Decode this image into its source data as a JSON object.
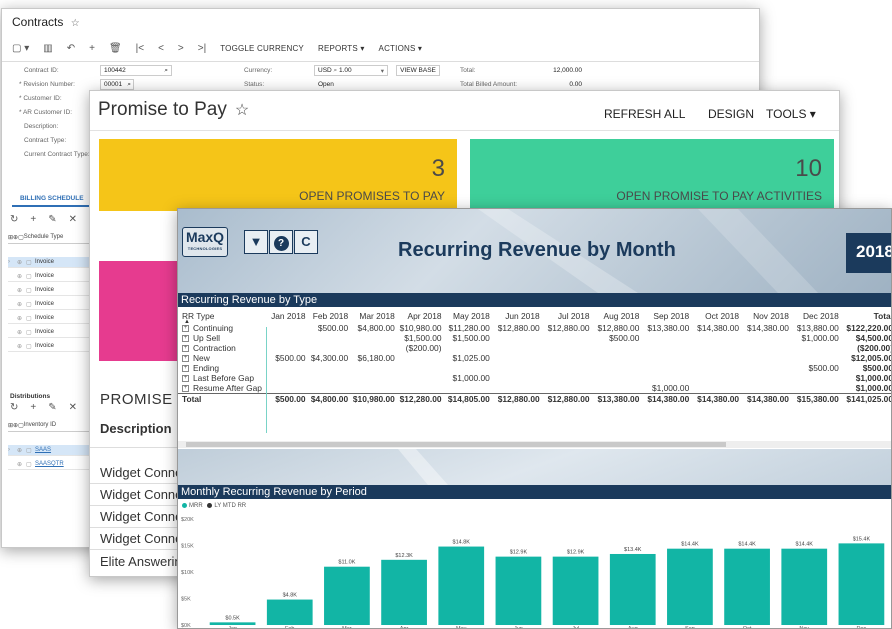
{
  "contracts": {
    "title": "Contracts",
    "star": "☆",
    "toolbar_icons": [
      "▢ ▾",
      "▥",
      "↶",
      "+",
      "🗑",
      "|<",
      "<",
      ">",
      ">|"
    ],
    "toolbar_text": [
      "TOGGLE CURRENCY",
      "REPORTS ▾",
      "ACTIONS ▾"
    ],
    "fields": [
      {
        "label": "Contract ID:",
        "value": "100442"
      },
      {
        "label": "* Revision Number:",
        "value": "00001"
      },
      {
        "label": "* Customer ID:",
        "value": ""
      },
      {
        "label": "* AR Customer ID:",
        "value": ""
      },
      {
        "label": "Description:",
        "value": ""
      },
      {
        "label": "Contract Type:",
        "value": ""
      },
      {
        "label": "Current Contract Type:",
        "value": ""
      }
    ],
    "currency_label": "Currency:",
    "currency_value": "USD",
    "rate": "1.00",
    "view_base": "VIEW BASE",
    "status_label": "Status:",
    "status_value": "Open",
    "total_label": "Total:",
    "total_value": "12,000.00",
    "billed_label": "Total Billed Amount:",
    "billed_value": "0.00",
    "billing_tab": "BILLING SCHEDULE",
    "billing_header": "Schedule Type",
    "billing_rows": [
      "Invoice",
      "Invoice",
      "Invoice",
      "Invoice",
      "Invoice",
      "Invoice",
      "Invoice"
    ],
    "distributions_label": "Distributions",
    "dist_header": "Inventory ID",
    "dist_rows": [
      "SAAS",
      "SAASQTR"
    ]
  },
  "ptp": {
    "title": "Promise to Pay",
    "star": "☆",
    "refresh": "REFRESH ALL",
    "design": "DESIGN",
    "tools": "TOOLS ▾",
    "tile1_num": "3",
    "tile1_label": "OPEN PROMISES TO PAY",
    "tile2_num": "10",
    "tile2_label": "OPEN PROMISE TO PAY ACTIVITIES",
    "section": "PROMISE",
    "desc_header": "Description",
    "rows": [
      "Widget Conne",
      "Widget Conne",
      "Widget Conne",
      "Widget Conne",
      "Elite Answerin"
    ]
  },
  "rr": {
    "logo": "MaxQ",
    "logo_sub": "TECHNOLOGIES",
    "btn_filter": "▼",
    "btn_help": "?",
    "btn_refresh": "C",
    "title": "Recurring Revenue by Month",
    "year": "2018",
    "section1": "Recurring Revenue by Type",
    "section2": "Monthly Recurring Revenue by Period",
    "table": {
      "headers": [
        "RR Type",
        "Jan 2018",
        "Feb 2018",
        "Mar 2018",
        "Apr 2018",
        "May 2018",
        "Jun 2018",
        "Jul 2018",
        "Aug 2018",
        "Sep 2018",
        "Oct 2018",
        "Nov 2018",
        "Dec 2018",
        "Total"
      ],
      "rows": [
        [
          "Continuing",
          "",
          "$500.00",
          "$4,800.00",
          "$10,980.00",
          "$11,280.00",
          "$12,880.00",
          "$12,880.00",
          "$12,880.00",
          "$13,380.00",
          "$14,380.00",
          "$14,380.00",
          "$13,880.00",
          "$122,220.00"
        ],
        [
          "Up Sell",
          "",
          "",
          "",
          "$1,500.00",
          "$1,500.00",
          "",
          "",
          "$500.00",
          "",
          "",
          "",
          "$1,000.00",
          "$4,500.00"
        ],
        [
          "Contraction",
          "",
          "",
          "",
          "($200.00)",
          "",
          "",
          "",
          "",
          "",
          "",
          "",
          "",
          "($200.00)"
        ],
        [
          "New",
          "$500.00",
          "$4,300.00",
          "$6,180.00",
          "",
          "$1,025.00",
          "",
          "",
          "",
          "",
          "",
          "",
          "",
          "$12,005.00"
        ],
        [
          "Ending",
          "",
          "",
          "",
          "",
          "",
          "",
          "",
          "",
          "",
          "",
          "",
          "$500.00",
          "$500.00"
        ],
        [
          "Last Before Gap",
          "",
          "",
          "",
          "",
          "$1,000.00",
          "",
          "",
          "",
          "",
          "",
          "",
          "",
          "$1,000.00"
        ],
        [
          "Resume After Gap",
          "",
          "",
          "",
          "",
          "",
          "",
          "",
          "",
          "$1,000.00",
          "",
          "",
          "",
          "$1,000.00"
        ]
      ],
      "total": [
        "Total",
        "$500.00",
        "$4,800.00",
        "$10,980.00",
        "$12,280.00",
        "$14,805.00",
        "$12,880.00",
        "$12,880.00",
        "$13,380.00",
        "$14,380.00",
        "$14,380.00",
        "$14,380.00",
        "$15,380.00",
        "$141,025.00"
      ]
    },
    "legend_mrr": "MRR",
    "legend_ly": "LY MTD RR",
    "colors": {
      "navy": "#1b3a5c",
      "teal": "#12b5a5",
      "legend_ly": "#333333"
    }
  },
  "chart_data": {
    "type": "bar",
    "categories": [
      "Jan",
      "Feb",
      "Mar",
      "Apr",
      "May",
      "Jun",
      "Jul",
      "Aug",
      "Sep",
      "Oct",
      "Nov",
      "Dec"
    ],
    "values": [
      0.5,
      4.8,
      11.0,
      12.3,
      14.8,
      12.9,
      12.9,
      13.4,
      14.4,
      14.4,
      14.4,
      15.4
    ],
    "labels": [
      "$0.5K",
      "$4.8K",
      "$11.0K",
      "$12.3K",
      "$14.8K",
      "$12.9K",
      "$12.9K",
      "$13.4K",
      "$14.4K",
      "$14.4K",
      "$14.4K",
      "$15.4K"
    ],
    "yticks": [
      "$0K",
      "$5K",
      "$10K",
      "$15K",
      "$20K"
    ],
    "ylim": [
      0,
      20
    ],
    "series": [
      {
        "name": "MRR",
        "values": [
          0.5,
          4.8,
          11.0,
          12.3,
          14.8,
          12.9,
          12.9,
          13.4,
          14.4,
          14.4,
          14.4,
          15.4
        ]
      }
    ],
    "title": "Monthly Recurring Revenue by Period"
  }
}
